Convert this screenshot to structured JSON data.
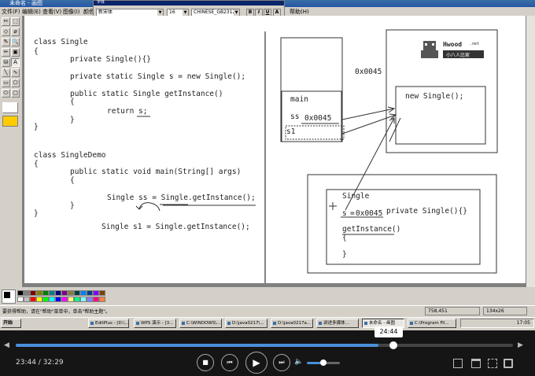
{
  "window": {
    "title": "未命名 - 画图"
  },
  "menu": [
    "文件(F)",
    "编辑(E)",
    "查看(V)",
    "图像(I)",
    "颜色(C)",
    "帮助(H)"
  ],
  "font_toolbar": {
    "caption": "字体",
    "font_name": "新宋体",
    "font_size": "16",
    "charset": "CHINESE_GB2312",
    "bold": "B",
    "italic": "I",
    "underline": "U",
    "vertical": "A"
  },
  "tools": [
    "✂",
    "⬚",
    "◇",
    "⌀",
    "✎",
    "🔍",
    "✏",
    "▣",
    "⛁",
    "A",
    "╲",
    "∿",
    "▭",
    "⬠",
    "⬭",
    "▢"
  ],
  "code_left": [
    "class Single",
    "{",
    "private Single(){}",
    "private static Single s = new Single();",
    "public static  Single getInstance()",
    "{",
    "return s;",
    "}",
    "}",
    "class SingleDemo",
    "{",
    "public static void main(String[] args)",
    "{",
    "Single ss = Single.getInstance();",
    "}",
    "Single s1 = Single.getInstance();",
    "}"
  ],
  "diagram": {
    "stack_main": "main",
    "stack_ss": "ss",
    "stack_ss_addr": "0x0045",
    "stack_s1": "s1",
    "heap_addr": "0x0045",
    "heap_obj": "new Single();",
    "logo_text": "Hwood",
    "logo_sub": ".net",
    "logo_cn": "小八人比家",
    "class_name": "Single",
    "class_field_s": "s",
    "class_field_eq": "=",
    "class_addr": "0x0045",
    "class_ctor": "private Single(){}",
    "class_method": "getInstance()",
    "class_brace_open": "{",
    "class_brace_close": "}"
  },
  "palette": [
    "#000000",
    "#808080",
    "#800000",
    "#808000",
    "#008000",
    "#008080",
    "#000080",
    "#800080",
    "#808040",
    "#004040",
    "#0080ff",
    "#004080",
    "#8000ff",
    "#804000",
    "#ffffff",
    "#c0c0c0",
    "#ff0000",
    "#ffff00",
    "#00ff00",
    "#00ffff",
    "#0000ff",
    "#ff00ff",
    "#ffff80",
    "#00ff80",
    "#80ffff",
    "#8080ff",
    "#ff0080",
    "#ff8040"
  ],
  "status": {
    "help": "要获得帮助，请在\"帮助\"菜单中，单击\"帮助主题\"。",
    "coords": "758,451",
    "size": "134x26"
  },
  "taskbar": {
    "start": "开始",
    "tasks": [
      "EditPlus - [D:\\...",
      "WPS 演示 - [3...",
      "C:\\WINDOWS\\...",
      "D:\\java0217\\...",
      "D:\\java0217a...",
      "讲述多媒体...",
      "未命名 - 画图",
      "C:\\Program Fil..."
    ],
    "clock": "17:05"
  },
  "player": {
    "current_time": "23:44",
    "total_time": "32:29",
    "hover_time": "24:44",
    "progress": 0.73,
    "hover": 0.76,
    "volume": 0.5
  }
}
